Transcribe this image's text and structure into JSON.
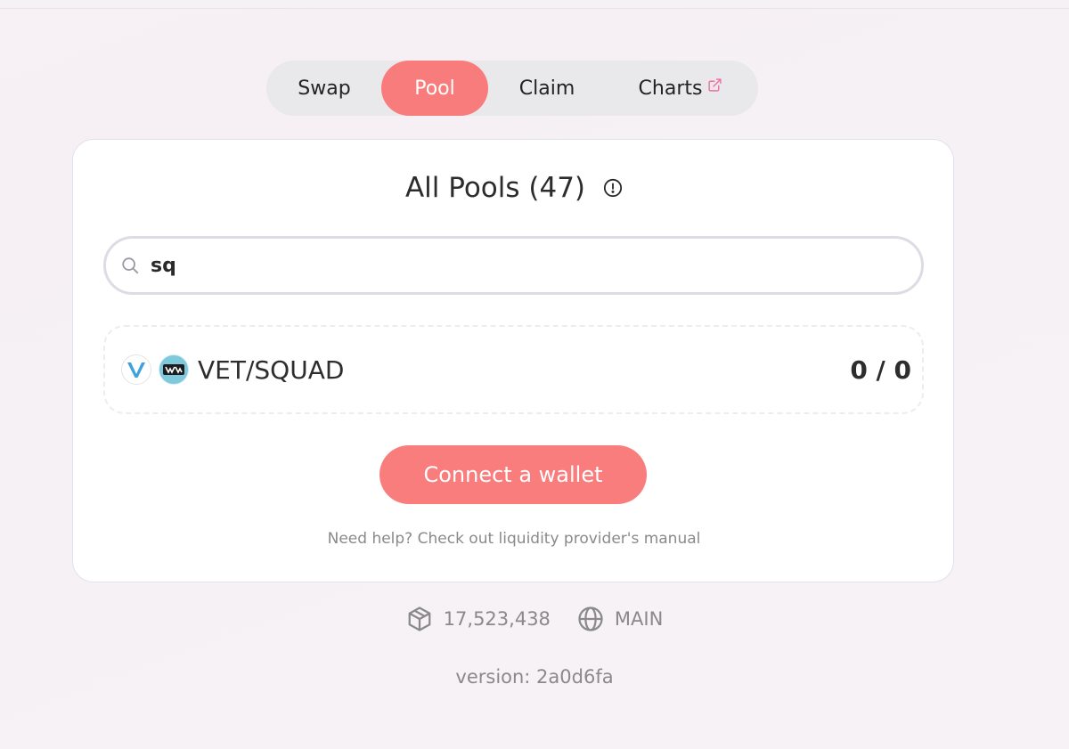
{
  "nav": {
    "tabs": [
      {
        "label": "Swap",
        "active": false
      },
      {
        "label": "Pool",
        "active": true
      },
      {
        "label": "Claim",
        "active": false
      },
      {
        "label": "Charts",
        "active": false,
        "external": true
      }
    ],
    "accent_color": "#f97c7c"
  },
  "pools": {
    "title": "All Pools (47)",
    "info_icon": "info-icon",
    "search": {
      "value": "sq",
      "icon": "search-icon"
    },
    "results": [
      {
        "pair": "VET/SQUAD",
        "token_a_icon": "vet-logo",
        "token_b_icon": "squad-logo",
        "balance": "0 / 0"
      }
    ],
    "connect_button": "Connect a wallet",
    "help_text": "Need help? Check out liquidity provider's manual"
  },
  "footer": {
    "block_icon": "cube-icon",
    "block_number": "17,523,438",
    "network_icon": "globe-icon",
    "network": "MAIN",
    "version": "version: 2a0d6fa"
  }
}
